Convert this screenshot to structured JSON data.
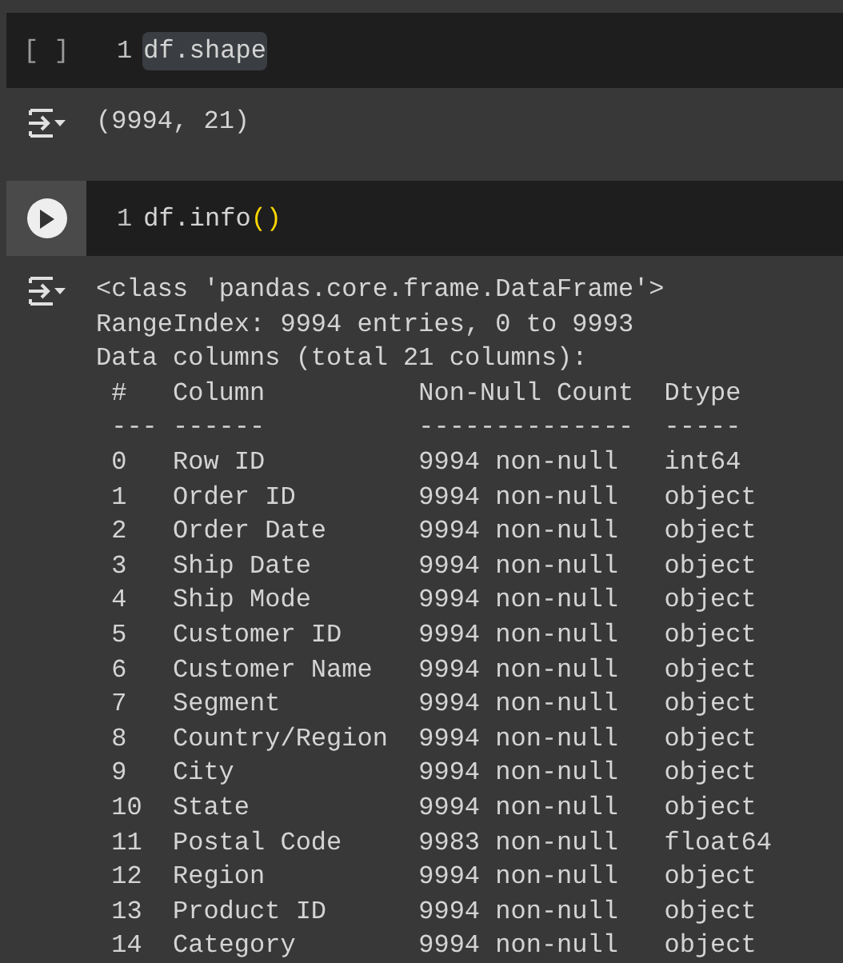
{
  "cells": [
    {
      "kind": "idle",
      "prompt": "[ ]",
      "line_number": "1",
      "code": [
        {
          "text": "df.shape",
          "kind": "plain"
        }
      ],
      "highlighted": true,
      "output": {
        "lines": [
          "(9994, 21)"
        ]
      }
    },
    {
      "kind": "run",
      "line_number": "1",
      "code": [
        {
          "text": "df.info",
          "kind": "plain"
        },
        {
          "text": "()",
          "kind": "bracket"
        }
      ],
      "highlighted": false,
      "output": {
        "lines": [
          "<class 'pandas.core.frame.DataFrame'>",
          "RangeIndex: 9994 entries, 0 to 9993",
          "Data columns (total 21 columns):"
        ],
        "table": {
          "columns": [
            {
              "label": "#",
              "rule": "---"
            },
            {
              "label": "Column",
              "rule": "------"
            },
            {
              "label": "Non-Null Count",
              "rule": "--------------"
            },
            {
              "label": "Dtype",
              "rule": "-----"
            }
          ],
          "rows": [
            [
              "0",
              "Row ID",
              "9994 non-null",
              "int64"
            ],
            [
              "1",
              "Order ID",
              "9994 non-null",
              "object"
            ],
            [
              "2",
              "Order Date",
              "9994 non-null",
              "object"
            ],
            [
              "3",
              "Ship Date",
              "9994 non-null",
              "object"
            ],
            [
              "4",
              "Ship Mode",
              "9994 non-null",
              "object"
            ],
            [
              "5",
              "Customer ID",
              "9994 non-null",
              "object"
            ],
            [
              "6",
              "Customer Name",
              "9994 non-null",
              "object"
            ],
            [
              "7",
              "Segment",
              "9994 non-null",
              "object"
            ],
            [
              "8",
              "Country/Region",
              "9994 non-null",
              "object"
            ],
            [
              "9",
              "City",
              "9994 non-null",
              "object"
            ],
            [
              "10",
              "State",
              "9994 non-null",
              "object"
            ],
            [
              "11",
              "Postal Code",
              "9983 non-null",
              "float64"
            ],
            [
              "12",
              "Region",
              "9994 non-null",
              "object"
            ],
            [
              "13",
              "Product ID",
              "9994 non-null",
              "object"
            ],
            [
              "14",
              "Category",
              "9994 non-null",
              "object"
            ]
          ]
        }
      }
    }
  ]
}
